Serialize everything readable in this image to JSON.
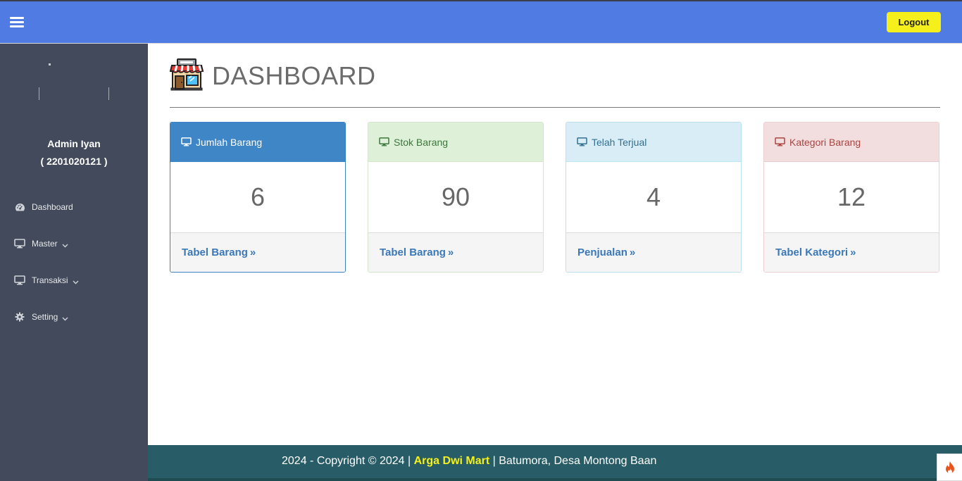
{
  "topbar": {
    "menu_icon": "hamburger-icon",
    "logout_label": "Logout",
    "bg_color": "#4f7be3",
    "logout_color": "#f5f01c"
  },
  "sidebar": {
    "user_name": "Admin Iyan",
    "user_id": "( 2201020121 )",
    "items": [
      {
        "label": "Dashboard",
        "icon": "dashboard-gauge-icon",
        "has_chevron": false
      },
      {
        "label": "Master",
        "icon": "monitor-icon",
        "has_chevron": true
      },
      {
        "label": "Transaksi",
        "icon": "monitor-icon",
        "has_chevron": true
      },
      {
        "label": "Setting",
        "icon": "gear-icon",
        "has_chevron": true
      }
    ]
  },
  "main": {
    "title": "DASHBOARD",
    "title_icon": "store-icon",
    "cards": [
      {
        "heading": "Jumlah Barang",
        "value": "6",
        "link": "Tabel Barang",
        "icon": "monitor-icon"
      },
      {
        "heading": "Stok Barang",
        "value": "90",
        "link": "Tabel Barang",
        "icon": "monitor-icon"
      },
      {
        "heading": "Telah Terjual",
        "value": "4",
        "link": "Penjualan",
        "icon": "monitor-icon"
      },
      {
        "heading": "Kategori Barang",
        "value": "12",
        "link": "Tabel Kategori",
        "icon": "monitor-icon"
      }
    ],
    "link_arrow": "»"
  },
  "footer": {
    "prefix": "2024 - Copyright © 2024 | ",
    "brand": "Arga Dwi Mart",
    "suffix": " | Batumora, Desa Montong Baan",
    "bg_color": "#285c66",
    "brand_color": "#f5f01c"
  }
}
